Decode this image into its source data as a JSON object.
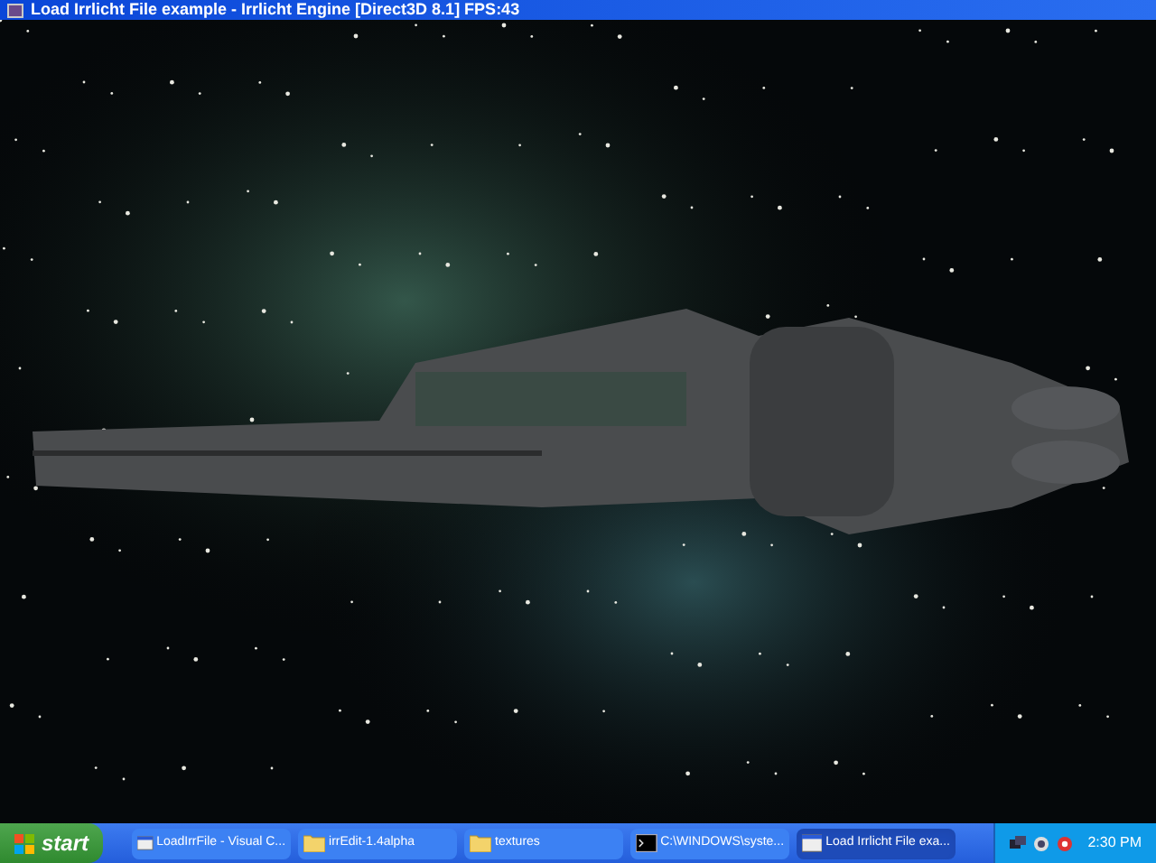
{
  "window": {
    "title": "Load Irrlicht File example - Irrlicht Engine [Direct3D 8.1] FPS:43"
  },
  "taskbar": {
    "start": "start",
    "items": [
      {
        "label": "LoadIrrFile - Visual C...",
        "kind": "app",
        "selected": false
      },
      {
        "label": "irrEdit-1.4alpha",
        "kind": "folder",
        "selected": false
      },
      {
        "label": "textures",
        "kind": "folder",
        "selected": false
      },
      {
        "label": "C:\\WINDOWS\\syste...",
        "kind": "console",
        "selected": false
      },
      {
        "label": "Load Irrlicht File exa...",
        "kind": "app",
        "selected": true
      }
    ],
    "clock": "2:30 PM"
  }
}
